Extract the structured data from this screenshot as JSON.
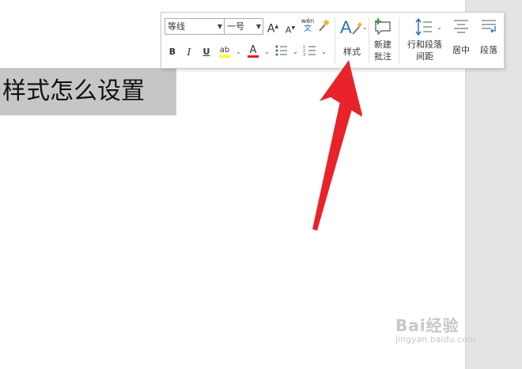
{
  "document": {
    "selected_text": "样式怎么设置"
  },
  "toolbar": {
    "font_name": "等线",
    "font_size": "一号",
    "grow_font_glyph": "A",
    "shrink_font_glyph": "A",
    "phonetic_top": "wén",
    "phonetic_bottom": "文",
    "bold": "B",
    "italic": "I",
    "underline": "U",
    "highlight_glyph": "ab",
    "font_color_glyph": "A",
    "styles_label": "样式",
    "new_comment_line1": "新建",
    "new_comment_line2": "批注",
    "line_spacing_line1": "行和段落",
    "line_spacing_line2": "间距",
    "center_label": "居中",
    "paragraph_label": "段落",
    "dropdown_glyph": "⌄"
  },
  "colors": {
    "highlight": "#ffff00",
    "font_color": "#e81b23",
    "arrow": "#e8232a",
    "styles_icon": "#2f6fb5"
  },
  "watermark": {
    "brand": "Bai经验",
    "url": "jingyan.baidu.com"
  }
}
